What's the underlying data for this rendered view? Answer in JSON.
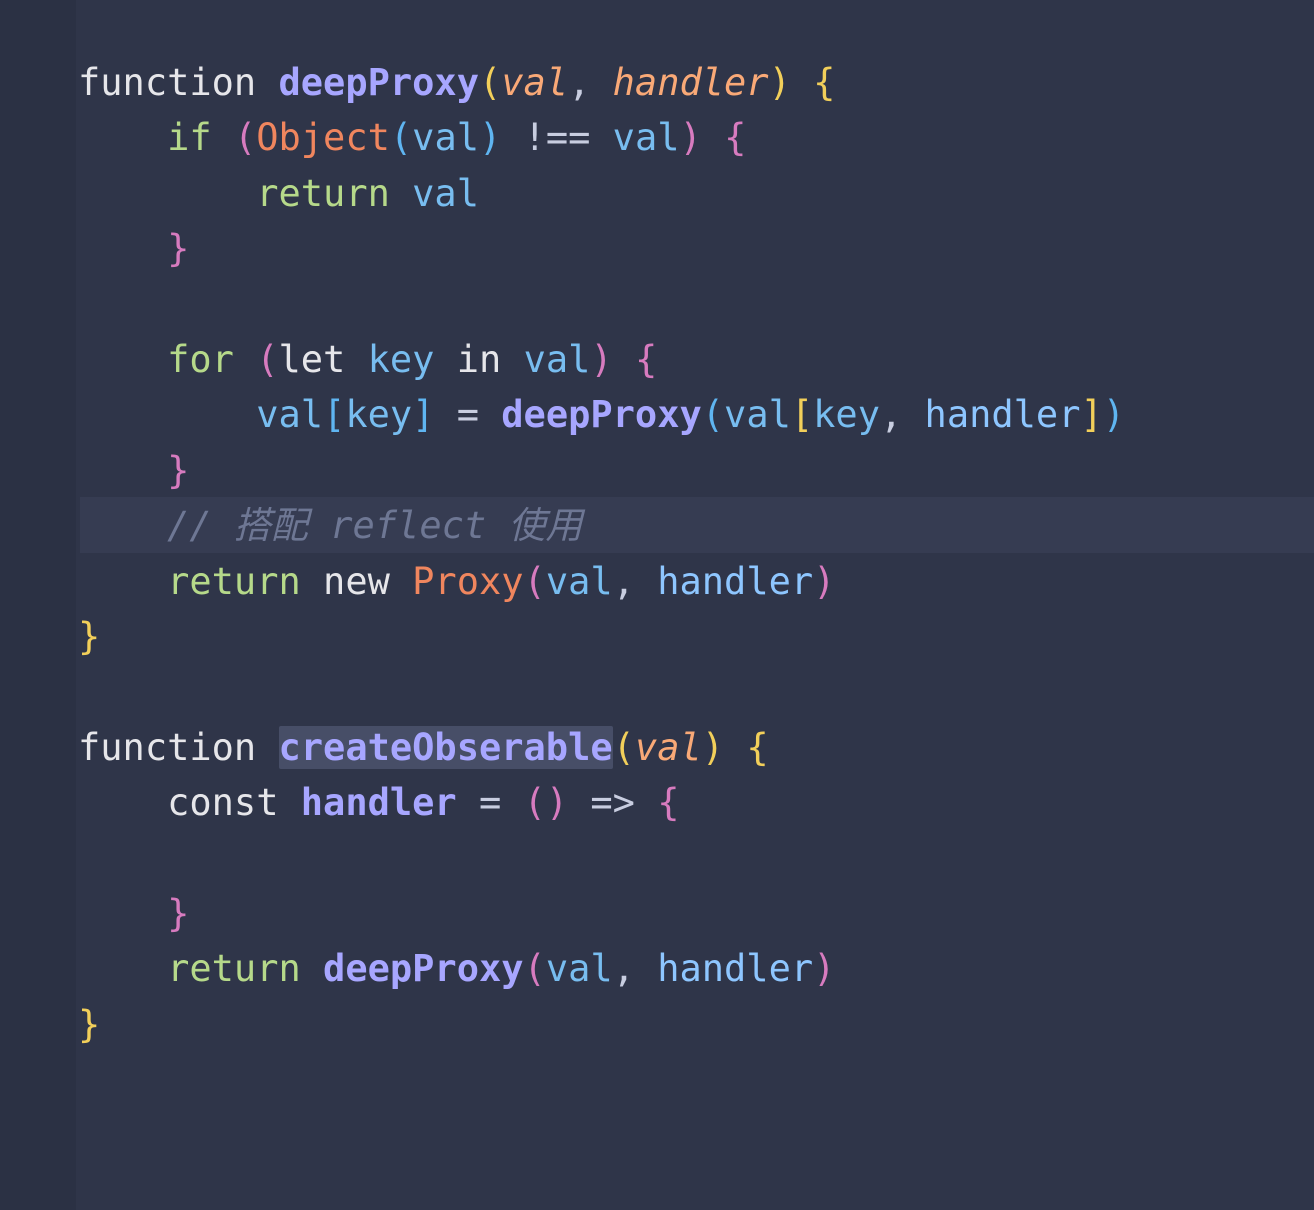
{
  "editor": {
    "language": "javascript",
    "colors": {
      "background": "#2f3549",
      "gutter": "#2b3144",
      "current_line": "#363c52",
      "keyword": "#e6e6ea",
      "control": "#b6d98a",
      "function": "#a7a6ff",
      "param": "#f9a977",
      "variable": "#78bdf0",
      "class": "#f0865e",
      "comment": "#6e7794"
    },
    "lines": [
      [
        [
          "k-kw",
          "function"
        ],
        [
          "k-punc",
          " "
        ],
        [
          "k-fn",
          "deepProxy"
        ],
        [
          "k-br1",
          "("
        ],
        [
          "k-param",
          "val"
        ],
        [
          "k-punc",
          ", "
        ],
        [
          "k-param",
          "handler"
        ],
        [
          "k-br1",
          ")"
        ],
        [
          "k-punc",
          " "
        ],
        [
          "k-br1",
          "{"
        ]
      ],
      [
        [
          "k-punc",
          "    "
        ],
        [
          "k-ctl",
          "if"
        ],
        [
          "k-punc",
          " "
        ],
        [
          "k-br2",
          "("
        ],
        [
          "k-cls",
          "Object"
        ],
        [
          "k-br3",
          "("
        ],
        [
          "k-var",
          "val"
        ],
        [
          "k-br3",
          ")"
        ],
        [
          "k-punc",
          " "
        ],
        [
          "k-op",
          "!=="
        ],
        [
          "k-punc",
          " "
        ],
        [
          "k-var",
          "val"
        ],
        [
          "k-br2",
          ")"
        ],
        [
          "k-punc",
          " "
        ],
        [
          "k-br2",
          "{"
        ]
      ],
      [
        [
          "k-punc",
          "        "
        ],
        [
          "k-ctl",
          "return"
        ],
        [
          "k-punc",
          " "
        ],
        [
          "k-var",
          "val"
        ]
      ],
      [
        [
          "k-punc",
          "    "
        ],
        [
          "k-br2",
          "}"
        ]
      ],
      [],
      [
        [
          "k-punc",
          "    "
        ],
        [
          "k-ctl",
          "for"
        ],
        [
          "k-punc",
          " "
        ],
        [
          "k-br2",
          "("
        ],
        [
          "k-kw",
          "let"
        ],
        [
          "k-punc",
          " "
        ],
        [
          "k-var",
          "key"
        ],
        [
          "k-punc",
          " "
        ],
        [
          "k-kw",
          "in"
        ],
        [
          "k-punc",
          " "
        ],
        [
          "k-var",
          "val"
        ],
        [
          "k-br2",
          ")"
        ],
        [
          "k-punc",
          " "
        ],
        [
          "k-br2",
          "{"
        ]
      ],
      [
        [
          "k-punc",
          "        "
        ],
        [
          "k-var",
          "val"
        ],
        [
          "k-br3",
          "["
        ],
        [
          "k-var",
          "key"
        ],
        [
          "k-br3",
          "]"
        ],
        [
          "k-punc",
          " "
        ],
        [
          "k-op",
          "="
        ],
        [
          "k-punc",
          " "
        ],
        [
          "k-fn",
          "deepProxy"
        ],
        [
          "k-br3",
          "("
        ],
        [
          "k-var",
          "val"
        ],
        [
          "k-br1",
          "["
        ],
        [
          "k-var",
          "key"
        ],
        [
          "k-punc",
          ", "
        ],
        [
          "k-prop",
          "handler"
        ],
        [
          "k-br1",
          "]"
        ],
        [
          "k-br3",
          ")"
        ]
      ],
      [
        [
          "k-punc",
          "    "
        ],
        [
          "k-br2",
          "}"
        ]
      ],
      [
        [
          "k-punc",
          "    "
        ],
        [
          "k-cmt",
          "// 搭配 reflect 使用"
        ]
      ],
      [
        [
          "k-punc",
          "    "
        ],
        [
          "k-ctl",
          "return"
        ],
        [
          "k-punc",
          " "
        ],
        [
          "k-kw",
          "new"
        ],
        [
          "k-punc",
          " "
        ],
        [
          "k-cls",
          "Proxy"
        ],
        [
          "k-br2",
          "("
        ],
        [
          "k-var",
          "val"
        ],
        [
          "k-punc",
          ", "
        ],
        [
          "k-prop",
          "handler"
        ],
        [
          "k-br2",
          ")"
        ]
      ],
      [
        [
          "k-br1",
          "}"
        ]
      ],
      [],
      [
        [
          "k-kw",
          "function"
        ],
        [
          "k-punc",
          " "
        ],
        [
          "k-fn sel",
          "createObserable"
        ],
        [
          "k-br1",
          "("
        ],
        [
          "k-param",
          "val"
        ],
        [
          "k-br1",
          ")"
        ],
        [
          "k-punc",
          " "
        ],
        [
          "k-br1",
          "{"
        ]
      ],
      [
        [
          "k-punc",
          "    "
        ],
        [
          "k-kw",
          "const"
        ],
        [
          "k-punc",
          " "
        ],
        [
          "k-fn",
          "handler"
        ],
        [
          "k-punc",
          " "
        ],
        [
          "k-op",
          "="
        ],
        [
          "k-punc",
          " "
        ],
        [
          "k-br2",
          "()"
        ],
        [
          "k-punc",
          " "
        ],
        [
          "k-op",
          "=>"
        ],
        [
          "k-punc",
          " "
        ],
        [
          "k-br2",
          "{"
        ]
      ],
      [],
      [
        [
          "k-punc",
          "    "
        ],
        [
          "k-br2",
          "}"
        ]
      ],
      [
        [
          "k-punc",
          "    "
        ],
        [
          "k-ctl",
          "return"
        ],
        [
          "k-punc",
          " "
        ],
        [
          "k-fn",
          "deepProxy"
        ],
        [
          "k-br2",
          "("
        ],
        [
          "k-var",
          "val"
        ],
        [
          "k-punc",
          ", "
        ],
        [
          "k-prop",
          "handler"
        ],
        [
          "k-br2",
          ")"
        ]
      ],
      [
        [
          "k-br1",
          "}"
        ]
      ]
    ]
  }
}
